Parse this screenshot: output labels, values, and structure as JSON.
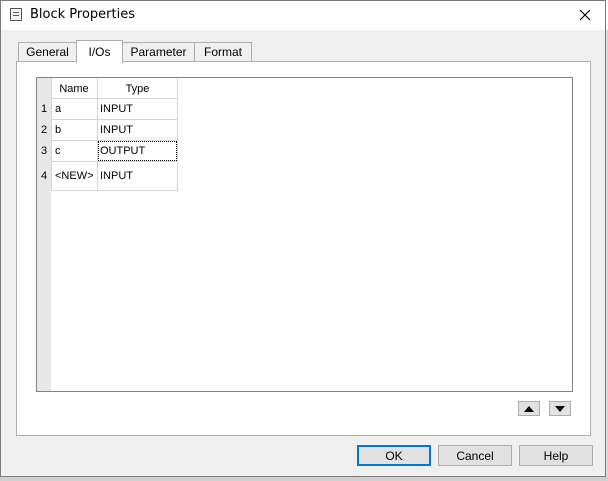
{
  "window": {
    "title": "Block Properties",
    "icon": "block-icon",
    "close_icon": "close-icon"
  },
  "tabs": [
    {
      "label": "General"
    },
    {
      "label": "I/Os",
      "active": true
    },
    {
      "label": "Parameter"
    },
    {
      "label": "Format"
    }
  ],
  "grid": {
    "columns": [
      {
        "label": "Name"
      },
      {
        "label": "Type"
      }
    ],
    "rows": [
      {
        "num": "1",
        "name": "a",
        "type": "INPUT"
      },
      {
        "num": "2",
        "name": "b",
        "type": "INPUT"
      },
      {
        "num": "3",
        "name": "c",
        "type": "OUTPUT",
        "focused": true
      },
      {
        "num": "4",
        "name": "<NEW>",
        "type": "INPUT"
      }
    ]
  },
  "move_buttons": {
    "up_icon": "arrow-up-icon",
    "down_icon": "arrow-down-icon"
  },
  "buttons": {
    "ok": "OK",
    "cancel": "Cancel",
    "help": "Help"
  },
  "colors": {
    "dialog_bg": "#f0f0f0",
    "default_button_border": "#0078d7"
  }
}
